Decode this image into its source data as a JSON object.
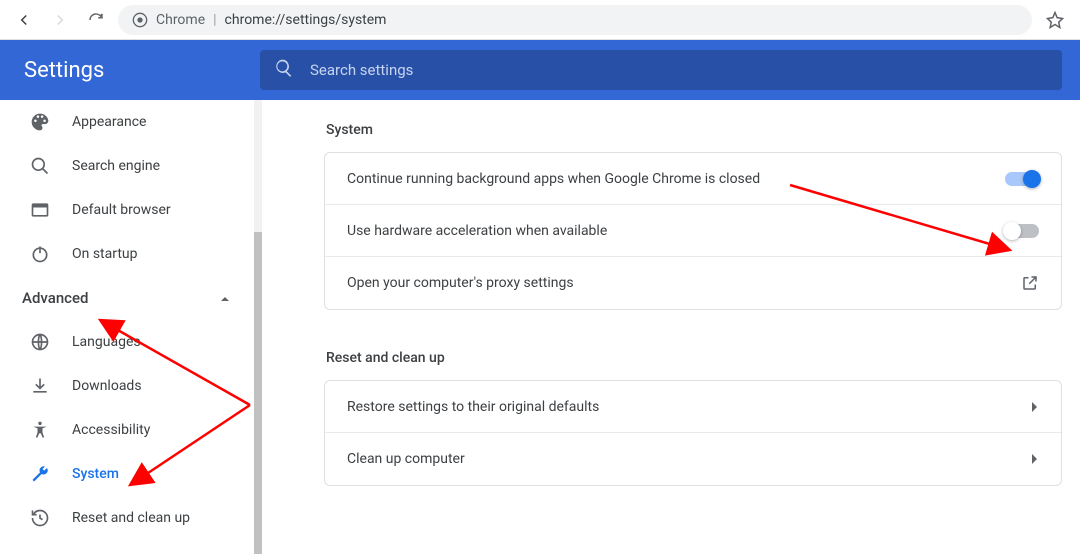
{
  "navbar": {
    "origin_label": "Chrome",
    "url": "chrome://settings/system"
  },
  "header": {
    "title": "Settings",
    "search_placeholder": "Search settings"
  },
  "sidebar": {
    "items_top": [
      {
        "label": "Appearance",
        "icon": "palette"
      },
      {
        "label": "Search engine",
        "icon": "search"
      },
      {
        "label": "Default browser",
        "icon": "browser"
      },
      {
        "label": "On startup",
        "icon": "power"
      }
    ],
    "advanced_label": "Advanced",
    "items_advanced": [
      {
        "label": "Languages",
        "icon": "globe"
      },
      {
        "label": "Downloads",
        "icon": "download"
      },
      {
        "label": "Accessibility",
        "icon": "accessibility"
      },
      {
        "label": "System",
        "icon": "wrench",
        "active": true
      },
      {
        "label": "Reset and clean up",
        "icon": "restore"
      }
    ]
  },
  "main": {
    "system": {
      "heading": "System",
      "rows": [
        {
          "label": "Continue running background apps when Google Chrome is closed",
          "toggle": "on"
        },
        {
          "label": "Use hardware acceleration when available",
          "toggle": "off"
        },
        {
          "label": "Open your computer's proxy settings",
          "action": "external"
        }
      ]
    },
    "reset": {
      "heading": "Reset and clean up",
      "rows": [
        {
          "label": "Restore settings to their original defaults",
          "action": "chevron"
        },
        {
          "label": "Clean up computer",
          "action": "chevron"
        }
      ]
    }
  }
}
